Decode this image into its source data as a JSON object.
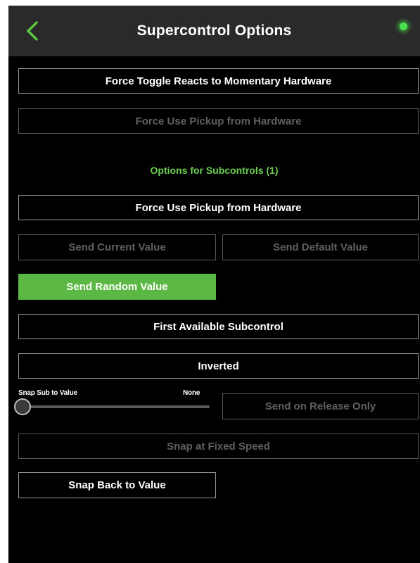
{
  "header": {
    "title": "Supercontrol Options",
    "back_icon": "chevron-left-icon",
    "status_icon": "status-dot-icon"
  },
  "options": {
    "force_toggle_label": "Force Toggle Reacts to Momentary Hardware",
    "force_pickup_label": "Force Use Pickup from Hardware"
  },
  "subcontrols": {
    "section_label": "Options for Subcontrols (1)",
    "force_pickup_label": "Force Use Pickup from Hardware",
    "send_current_label": "Send Current Value",
    "send_default_label": "Send Default Value",
    "send_random_label": "Send Random Value",
    "first_available_label": "First Available Subcontrol",
    "inverted_label": "Inverted",
    "snap_slider": {
      "label": "Snap Sub to Value",
      "value_label": "None",
      "value": 0
    },
    "send_on_release_label": "Send on Release Only",
    "snap_fixed_speed_label": "Snap at Fixed Speed",
    "snap_back_label": "Snap Back to Value"
  },
  "colors": {
    "accent_green": "#5cb844",
    "section_label_green": "#6cd04f",
    "status_green": "#4be04b",
    "header_bg": "#2a2a2a",
    "panel_bg": "#000000"
  }
}
